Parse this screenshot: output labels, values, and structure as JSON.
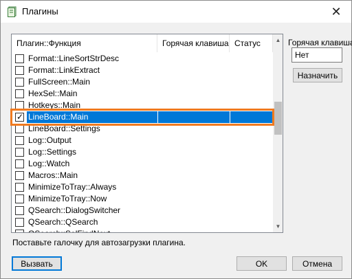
{
  "window": {
    "title": "Плагины",
    "icon": "plugin-icon",
    "close_glyph": "✕"
  },
  "list": {
    "columns": [
      "Плагин::Функция",
      "Горячая клавиша",
      "Статус"
    ],
    "rows": [
      {
        "name": "Format::LineSortStrDesc",
        "checked": false,
        "selected": false
      },
      {
        "name": "Format::LinkExtract",
        "checked": false,
        "selected": false
      },
      {
        "name": "FullScreen::Main",
        "checked": false,
        "selected": false
      },
      {
        "name": "HexSel::Main",
        "checked": false,
        "selected": false
      },
      {
        "name": "Hotkeys::Main",
        "checked": false,
        "selected": false
      },
      {
        "name": "LineBoard::Main",
        "checked": true,
        "selected": true
      },
      {
        "name": "LineBoard::Settings",
        "checked": false,
        "selected": false
      },
      {
        "name": "Log::Output",
        "checked": false,
        "selected": false
      },
      {
        "name": "Log::Settings",
        "checked": false,
        "selected": false
      },
      {
        "name": "Log::Watch",
        "checked": false,
        "selected": false
      },
      {
        "name": "Macros::Main",
        "checked": false,
        "selected": false
      },
      {
        "name": "MinimizeToTray::Always",
        "checked": false,
        "selected": false
      },
      {
        "name": "MinimizeToTray::Now",
        "checked": false,
        "selected": false
      },
      {
        "name": "QSearch::DialogSwitcher",
        "checked": false,
        "selected": false
      },
      {
        "name": "QSearch::QSearch",
        "checked": false,
        "selected": false
      },
      {
        "name": "QSearch::SelFindNext",
        "checked": false,
        "selected": false
      }
    ]
  },
  "hotkey": {
    "label": "Горячая клавиша:",
    "value": "Нет",
    "assign_label": "Назначить"
  },
  "note": "Поставьте галочку для автозагрузки плагина.",
  "buttons": {
    "call": "Вызвать",
    "ok": "OK",
    "cancel": "Отмена"
  },
  "colors": {
    "selection": "#0078d7",
    "highlight_frame": "#f07a1f"
  }
}
